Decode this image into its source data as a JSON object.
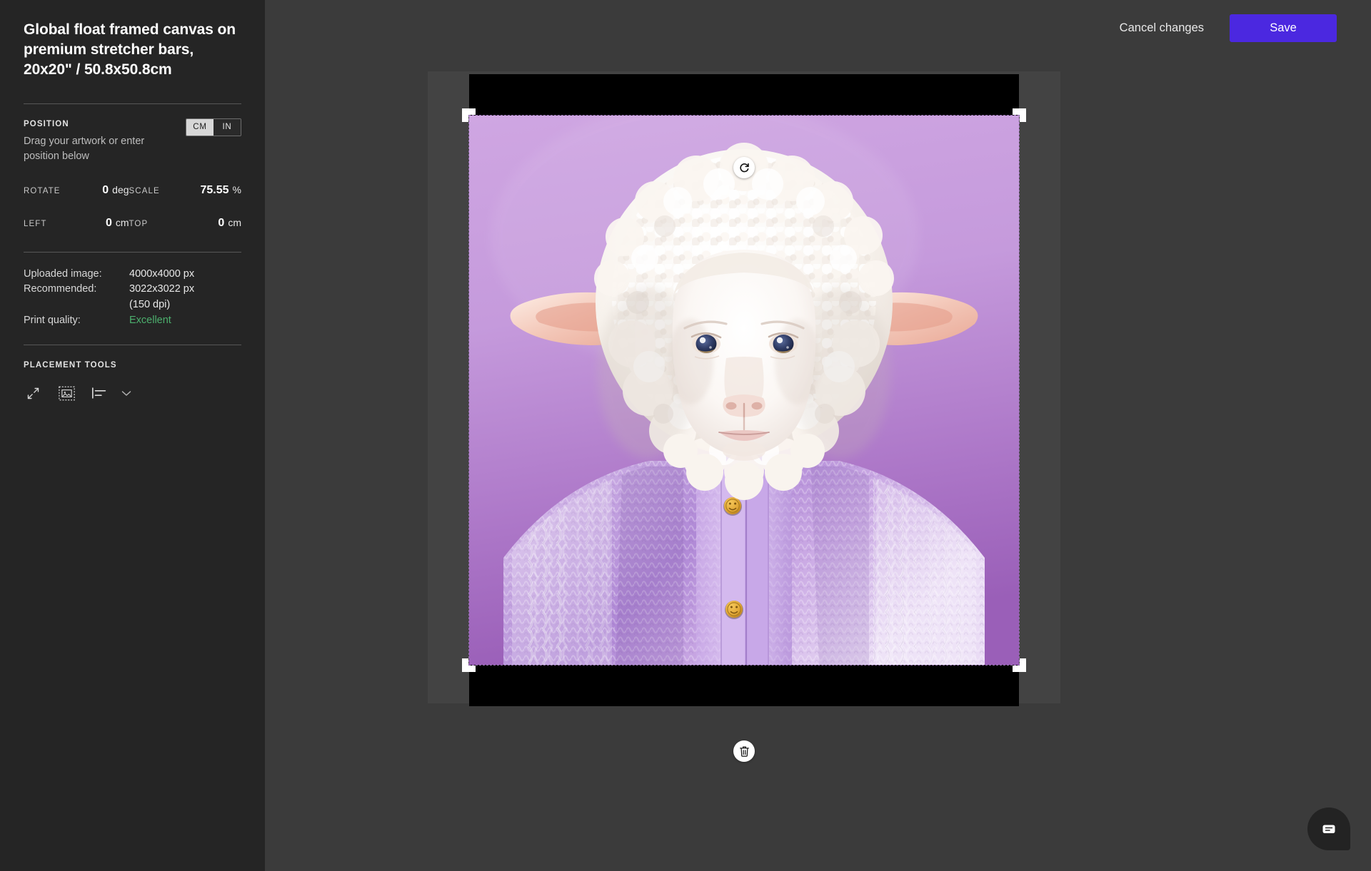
{
  "sidebar": {
    "title": "Global float framed canvas on premium stretcher bars, 20x20\" / 50.8x50.8cm",
    "position": {
      "label": "POSITION",
      "hint": "Drag your artwork or enter position below",
      "units": {
        "cm": "CM",
        "in": "IN",
        "selected": "IN"
      }
    },
    "fields": {
      "rotate": {
        "label": "ROTATE",
        "value": "0",
        "unit": "deg"
      },
      "scale": {
        "label": "SCALE",
        "value": "75.55",
        "unit": "%"
      },
      "left": {
        "label": "LEFT",
        "value": "0",
        "unit": "cm"
      },
      "top": {
        "label": "TOP",
        "value": "0",
        "unit": "cm"
      }
    },
    "info": {
      "uploaded_label": "Uploaded image:",
      "uploaded_value": "4000x4000 px",
      "recommended_label": "Recommended:",
      "recommended_value": "3022x3022 px",
      "recommended_value2": "(150 dpi)",
      "print_quality_label": "Print quality:",
      "print_quality_value": "Excellent",
      "print_quality_color": "#4caf6d"
    },
    "placement": {
      "label": "PLACEMENT TOOLS",
      "tools": [
        {
          "name": "scale-to-fit-icon"
        },
        {
          "name": "fit-image-icon"
        },
        {
          "name": "align-icon"
        },
        {
          "name": "chevron-down-icon"
        }
      ]
    }
  },
  "topbar": {
    "cancel_label": "Cancel changes",
    "save_label": "Save",
    "save_color": "#4b28e0"
  },
  "canvas": {
    "rotate_button": "rotate-icon",
    "delete_button": "trash-icon",
    "artwork_alt": "Sheep wearing lavender knitted cardigan on purple background",
    "background_color": "#3b3b3b",
    "frame_color": "#000000",
    "bleed_color": "#434343"
  },
  "chat": {
    "icon": "chat-bubble-icon"
  }
}
